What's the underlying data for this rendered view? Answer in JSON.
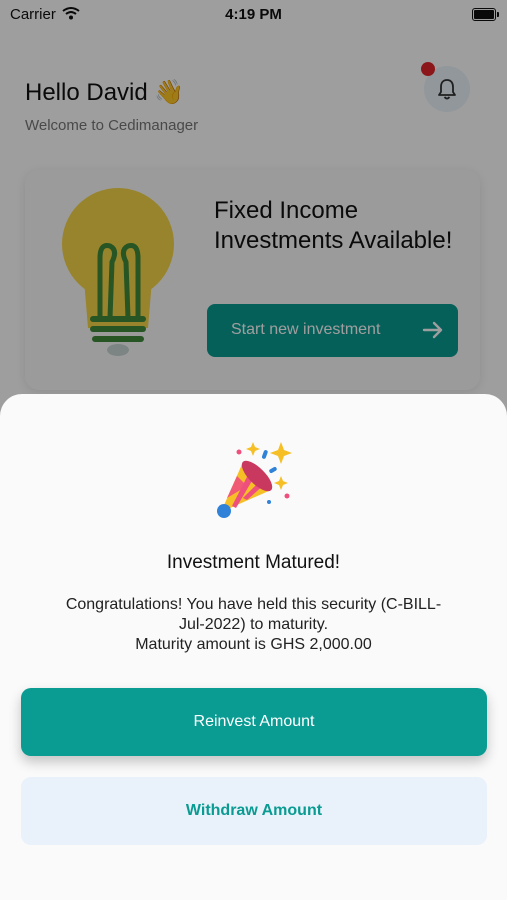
{
  "status_bar": {
    "carrier": "Carrier",
    "time": "4:19 PM"
  },
  "header": {
    "greeting": "Hello David 👋",
    "subtitle": "Welcome to Cedimanager",
    "notification_icon": "bell-icon"
  },
  "promo": {
    "title": "Fixed Income Investments Available!",
    "button_label": "Start new investment",
    "illustration": "lightbulb",
    "accent_color": "#0a9b92"
  },
  "modal": {
    "icon": "party-popper-icon",
    "title": "Investment Matured!",
    "message_line1": "Congratulations! You have held this security (C-BILL-",
    "message_line2": "Jul-2022) to maturity.",
    "message_line3": "Maturity amount is GHS 2,000.00",
    "primary_button": "Reinvest Amount",
    "secondary_button": "Withdraw Amount"
  },
  "colors": {
    "primary": "#0a9b92",
    "secondary_bg": "#e9f1fa",
    "notification_dot": "#e0262b"
  }
}
